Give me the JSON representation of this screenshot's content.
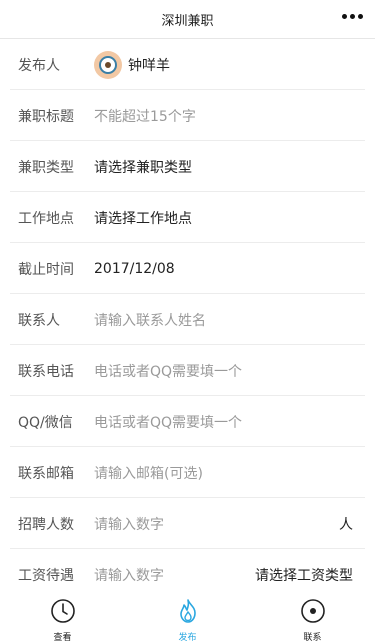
{
  "navbar": {
    "title": "深圳兼职"
  },
  "form": {
    "publisher": {
      "label": "发布人",
      "name": "钟咩羊"
    },
    "job_title": {
      "label": "兼职标题",
      "placeholder": "不能超过15个字"
    },
    "job_type": {
      "label": "兼职类型",
      "value": "请选择兼职类型"
    },
    "work_location": {
      "label": "工作地点",
      "value": "请选择工作地点"
    },
    "deadline": {
      "label": "截止时间",
      "value": "2017/12/08"
    },
    "contact_person": {
      "label": "联系人",
      "placeholder": "请输入联系人姓名"
    },
    "phone": {
      "label": "联系电话",
      "placeholder": "电话或者QQ需要填一个"
    },
    "qq_wechat": {
      "label": "QQ/微信",
      "placeholder": "电话或者QQ需要填一个"
    },
    "email": {
      "label": "联系邮箱",
      "placeholder": "请输入邮箱(可选)"
    },
    "headcount": {
      "label": "招聘人数",
      "placeholder": "请输入数字",
      "unit": "人"
    },
    "salary": {
      "label": "工资待遇",
      "placeholder": "请输入数字",
      "type_value": "请选择工资类型"
    }
  },
  "tabbar": {
    "tabs": [
      {
        "label": "查看",
        "icon": "clock-icon"
      },
      {
        "label": "发布",
        "icon": "flame-icon",
        "active": true
      },
      {
        "label": "联系",
        "icon": "circle-dot-icon"
      }
    ]
  },
  "colors": {
    "accent": "#2aa7e0",
    "divider": "#ececec",
    "placeholder": "#9a9a9a"
  }
}
